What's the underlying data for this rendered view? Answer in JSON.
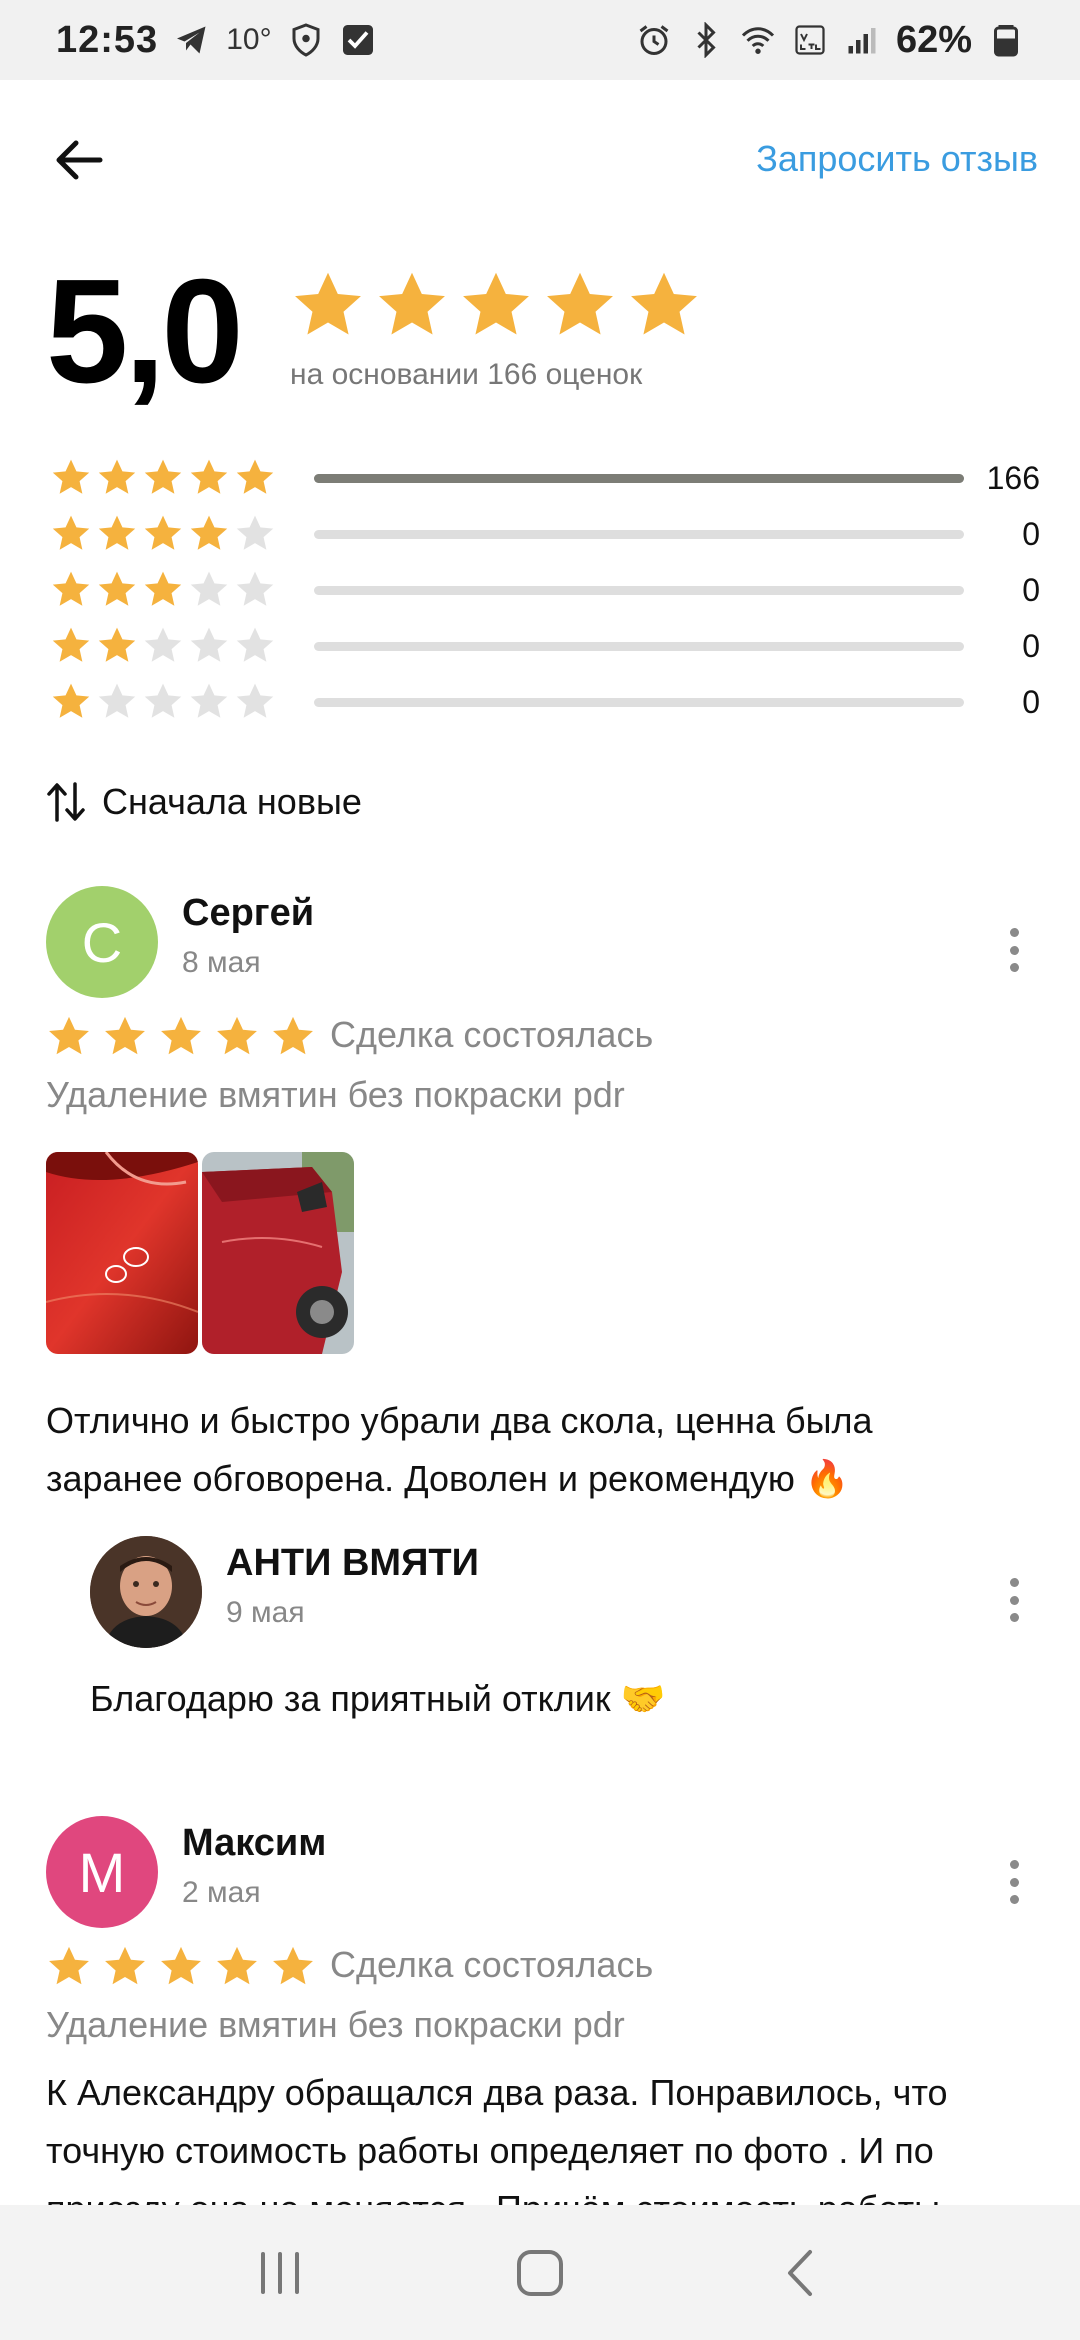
{
  "status_bar": {
    "time": "12:53",
    "temperature": "10°",
    "battery": "62%"
  },
  "header": {
    "request_review": "Запросить отзыв"
  },
  "summary": {
    "rating": "5,0",
    "based_on": "на основании 166 оценок",
    "distribution": [
      {
        "stars": 5,
        "count": "166",
        "fraction": 1.0
      },
      {
        "stars": 4,
        "count": "0",
        "fraction": 0
      },
      {
        "stars": 3,
        "count": "0",
        "fraction": 0
      },
      {
        "stars": 2,
        "count": "0",
        "fraction": 0
      },
      {
        "stars": 1,
        "count": "0",
        "fraction": 0
      }
    ]
  },
  "sort": {
    "label": "Сначала новые"
  },
  "reviews": [
    {
      "initial": "С",
      "avatar_color": "#a2d06c",
      "name": "Сергей",
      "date": "8 мая",
      "rating": 5,
      "status": "Сделка состоялась",
      "service": "Удаление вмятин без покраски pdr",
      "text_lines": [
        "Отлично и быстро убрали два скола, ценна была",
        "заранее обговорена. Доволен и рекомендую 🔥"
      ],
      "reply": {
        "name": "АНТИ ВМЯТИ",
        "date": "9 мая",
        "text": "Благодарю за приятный отклик 🤝"
      }
    },
    {
      "initial": "М",
      "avatar_color": "#e0477e",
      "name": "Максим",
      "date": "2 мая",
      "rating": 5,
      "status": "Сделка состоялась",
      "service": "Удаление вмятин без покраски pdr",
      "text_lines": [
        "К Александру обращался два  раза. Понравилось,  что",
        "точную стоимость работы определяет по фото . И по",
        "приезду она не меняется . Причём стоимость работы"
      ]
    }
  ],
  "colors": {
    "star": "#f5b23e",
    "star_empty": "#e2e2e2",
    "link": "#3a9ce0",
    "bar_fill": "#7c7d76",
    "bar_track": "#dedede"
  },
  "icons": {
    "back": "arrow-left-icon",
    "sort": "sort-arrows-icon",
    "more": "more-vertical-icon"
  }
}
